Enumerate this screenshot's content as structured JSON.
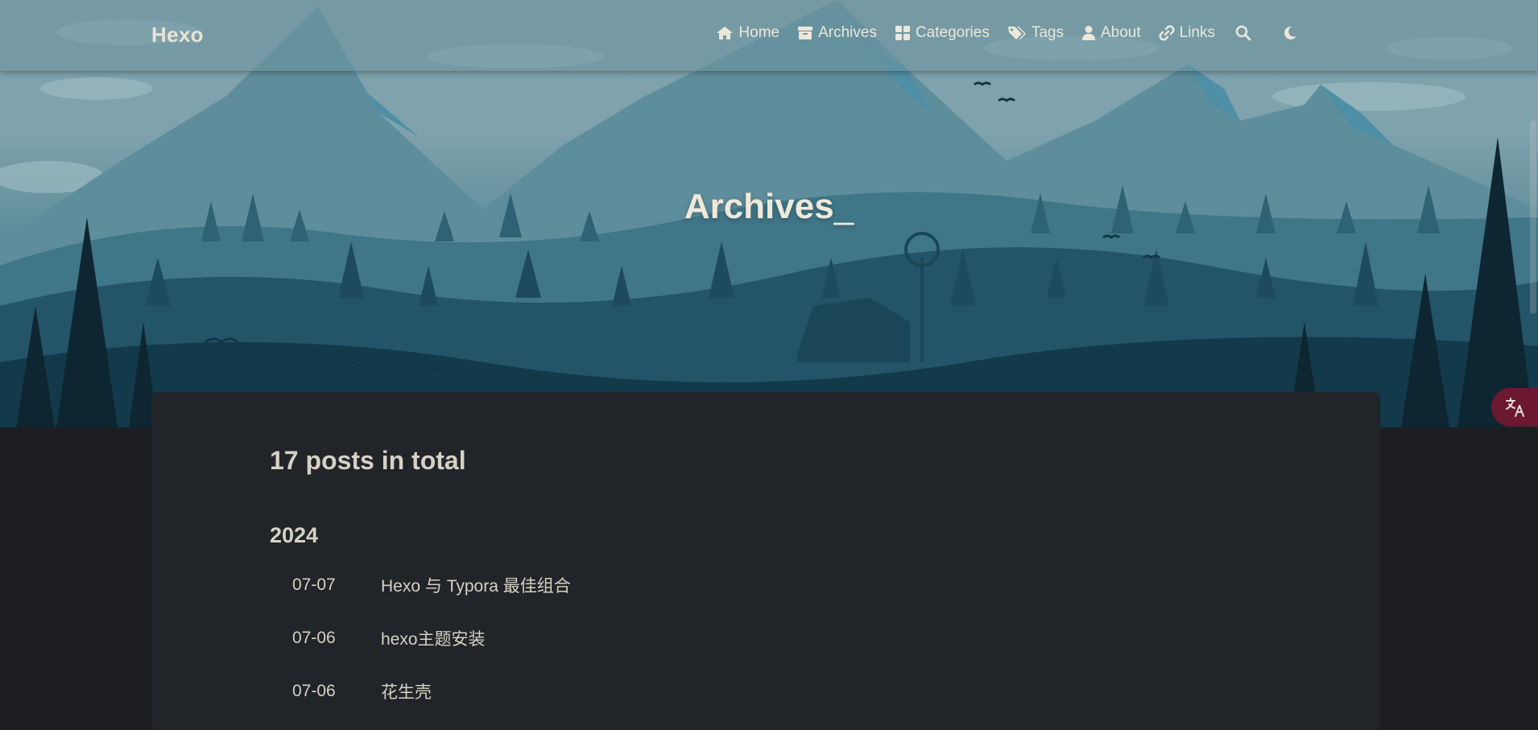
{
  "brand": "Hexo",
  "nav": {
    "items": [
      {
        "label": "Home",
        "icon": "home-icon"
      },
      {
        "label": "Archives",
        "icon": "archive-box-icon"
      },
      {
        "label": "Categories",
        "icon": "categories-grid-icon"
      },
      {
        "label": "Tags",
        "icon": "tags-icon"
      },
      {
        "label": "About",
        "icon": "user-icon"
      },
      {
        "label": "Links",
        "icon": "link-icon"
      }
    ],
    "search_icon": "search-icon",
    "theme_icon": "moon-icon"
  },
  "banner": {
    "title": "Archives",
    "cursor": "_"
  },
  "archive": {
    "total_text": "17 posts in total",
    "year": "2024",
    "posts": [
      {
        "date": "07-07",
        "title": "Hexo 与 Typora 最佳组合"
      },
      {
        "date": "07-06",
        "title": "hexo主题安装"
      },
      {
        "date": "07-06",
        "title": "花生壳"
      }
    ]
  },
  "floating": {
    "translate_icon": "translate-icon",
    "accent": "#6b1830"
  },
  "colors": {
    "page_bg": "#1c1e22",
    "card_bg": "#212428",
    "text": "#d6d1c4"
  }
}
